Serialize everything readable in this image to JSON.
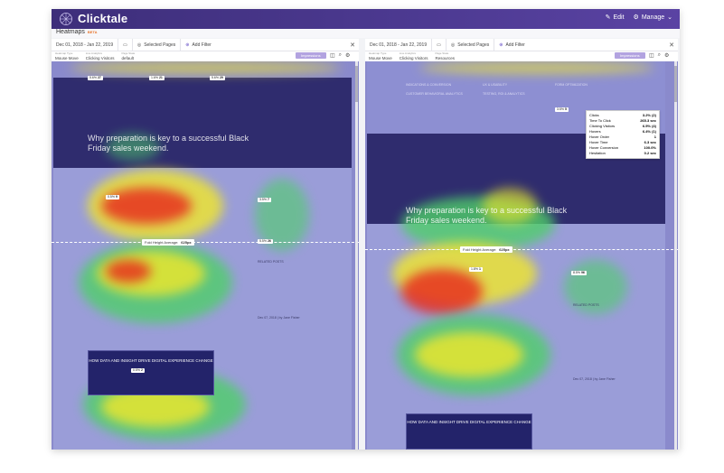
{
  "app": {
    "brand": "Clicktale",
    "edit_label": "Edit",
    "manage_label": "Manage",
    "page_title": "Heatmaps",
    "beta_label": "BETA"
  },
  "colors": {
    "topbar": "#4b3a8f",
    "accent_button": "#b2a3e0",
    "beta": "#e8762d",
    "heat_red": "#e8261c",
    "heat_yellow": "#f2e82a",
    "heat_green": "#4fcf6a",
    "heat_blue": "#7f8ad8"
  },
  "left_pane": {
    "date_range": "Dec 01, 2018 - Jan 22, 2019",
    "device_icon": "monitor-icon",
    "selected_pages": "Selected Pages",
    "add_filter": "Add Filter",
    "heatmap_type_caption": "Heatmap Type",
    "heatmap_type": "Mouse Move",
    "segment_caption": "Live Analytics",
    "segment": "Clicking Visitors",
    "page_state_caption": "Page State",
    "page_state": "default",
    "action_button": "Impressions",
    "hero_title": "Why preparation is key to a successful Black Friday sales weekend.",
    "fold_label": "Fold Height Average:",
    "fold_value": "625px",
    "promo_text": "HOW DATA AND INSIGHT DRIVE DIGITAL EXPERIENCE CHANGE",
    "related_label": "RELATED POSTS",
    "date_text": "Dec 07, 2018 | by Jane Fisher"
  },
  "right_pane": {
    "date_range": "Dec 01, 2018 - Jan 22, 2019",
    "device_icon": "monitor-icon",
    "selected_pages": "Selected Pages",
    "add_filter": "Add Filter",
    "heatmap_type_caption": "Heatmap Type",
    "heatmap_type": "Mouse Move",
    "segment_caption": "Live Analytics",
    "segment": "Clicking Visitors",
    "page_state_caption": "Page State",
    "page_state": "Resources",
    "action_button": "Impressions",
    "hero_title": "Why preparation is key to a successful Black Friday sales weekend.",
    "fold_label": "Fold Height Average:",
    "fold_value": "625px",
    "promo_text": "HOW DATA AND INSIGHT DRIVE DIGITAL EXPERIENCE CHANGE",
    "related_label": "RELATED POSTS",
    "date_text": "Dec 07, 2018 | by Jane Fisher",
    "menu": {
      "col1a": "INDICATIONS & CONVERSION",
      "col1b": "CUSTOMER BEHAVIORAL ANALYTICS",
      "col2a": "UX & USABILITY",
      "col2b": "TESTING, ROI & ANALYTICS",
      "col3a": "FORM OPTIMIZATION"
    },
    "tooltip": [
      {
        "label": "Clicks",
        "value": "3.2% (2)"
      },
      {
        "label": "Time To Click",
        "value": "265.3 sec"
      },
      {
        "label": "Clicking Visitors",
        "value": "6.5% (4)"
      },
      {
        "label": "Hovers",
        "value": "6.4% (1)"
      },
      {
        "label": "Hover Order",
        "value": "1"
      },
      {
        "label": "Hover Time",
        "value": "6.3 sec"
      },
      {
        "label": "Hover Conversion",
        "value": "100.0%"
      },
      {
        "label": "Hesitation",
        "value": "0.2 sec"
      }
    ]
  },
  "badges": {
    "b1": "5.6%",
    "b1n": "27",
    "b2": "1.6%",
    "b2n": "21",
    "b3": "5.6%",
    "b3n": "29",
    "b4": "0.5%",
    "b4n": "9",
    "b5": "3.5%",
    "b5n": "7",
    "b6": "5.5%",
    "b6n": "26",
    "b7": "0.5%",
    "b7n": "2",
    "b8": "3.5%",
    "b8n": "5",
    "b9": "1.8%",
    "b9n": "1",
    "b10": "8.5%",
    "b10n": "96"
  }
}
